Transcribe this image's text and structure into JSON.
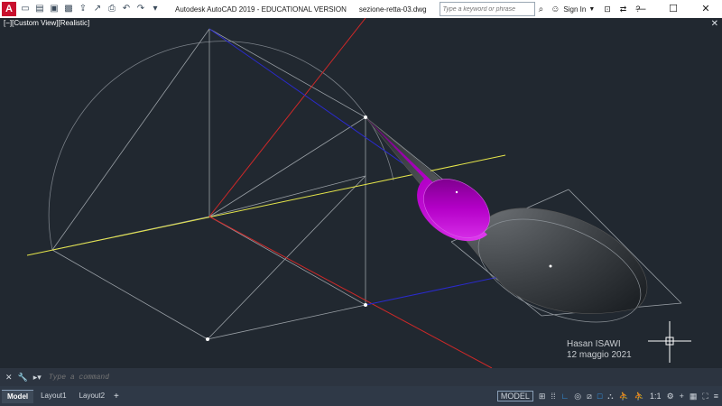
{
  "app": {
    "logo": "A",
    "title": "Autodesk AutoCAD 2019 - EDUCATIONAL VERSION",
    "filename": "sezione-retta-03.dwg"
  },
  "search": {
    "placeholder": "Type a keyword or phrase"
  },
  "account": {
    "sign_in": "Sign In"
  },
  "viewport": {
    "label": "[−][Custom View][Realistic]"
  },
  "watermark": {
    "author": "Hasan ISAWI",
    "date": "12 maggio 2021"
  },
  "command": {
    "placeholder": "Type a command"
  },
  "layout_tabs": [
    {
      "label": "Model"
    },
    {
      "label": "Layout1"
    },
    {
      "label": "Layout2"
    }
  ],
  "status": {
    "model": "MODEL",
    "scale": "1:1"
  },
  "colors": {
    "background": "#212830",
    "axis_yellow": "#e6e64a",
    "axis_red": "#d02828",
    "axis_blue": "#2a2acc",
    "cone_magenta": "#b400c8",
    "cone_grey": "#4a4e52"
  }
}
